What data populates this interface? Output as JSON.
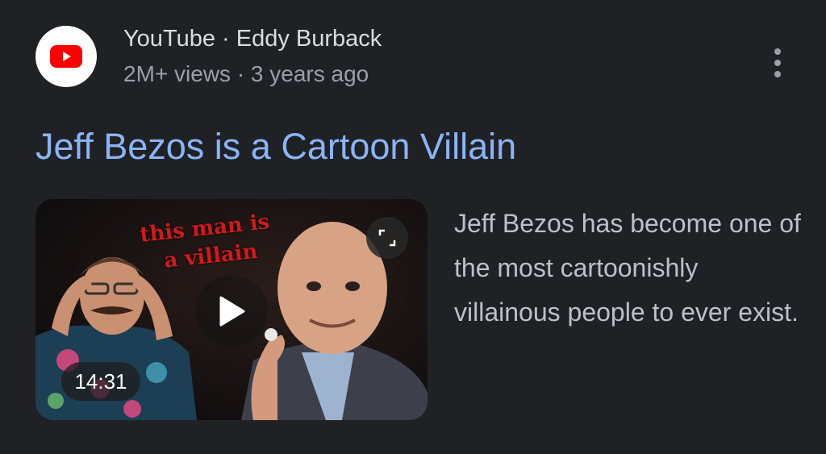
{
  "result": {
    "source_line": "YouTube · Eddy Burback",
    "meta_line": "2M+ views · 3 years ago",
    "title": "Jeff Bezos is a Cartoon Villain",
    "snippet": "Jeff Bezos has become one of the most cartoonishly villainous people to ever exist.",
    "thumbnail": {
      "overlay_line1": "this man is",
      "overlay_line2": "a villain",
      "duration": "14:31"
    }
  },
  "icons": {
    "avatar": "youtube-logo-icon",
    "more": "more-vert-icon",
    "play": "play-icon",
    "expand": "fullscreen-icon"
  },
  "colors": {
    "background": "#202124",
    "title": "#8ab4f8",
    "youtube_red": "#ff0000"
  }
}
